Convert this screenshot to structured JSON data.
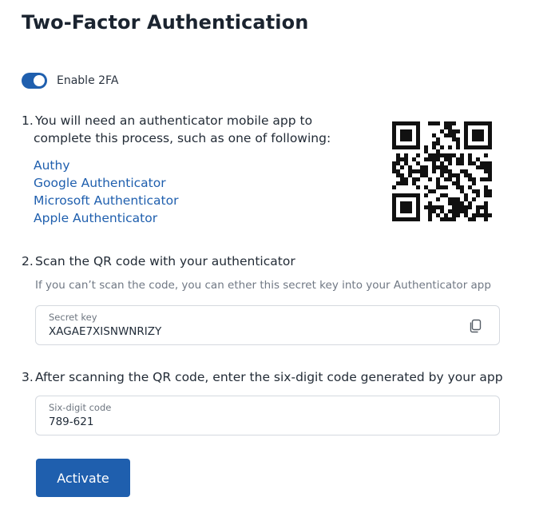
{
  "page": {
    "title": "Two-Factor Authentication"
  },
  "toggle": {
    "label": "Enable 2FA",
    "enabled": true,
    "accent": "#1f5fae"
  },
  "step1": {
    "number": "1.",
    "line1": "You will need an authenticator mobile app to",
    "line2": "complete this process, such as one of following:",
    "apps": [
      "Authy",
      "Google Authenticator",
      "Microsoft Authenticator",
      "Apple Authenticator"
    ]
  },
  "qr": {
    "icon": "qr-code"
  },
  "step2": {
    "number": "2.",
    "text": "Scan the QR code with your authenticator",
    "hint": "If you can’t scan the code, you can ether this secret key into your Authenticator app"
  },
  "secret": {
    "label": "Secret key",
    "value": "XAGAE7XISNWNRIZY",
    "icon": "copy-icon"
  },
  "step3": {
    "number": "3.",
    "text": "After scanning the QR code, enter the six-digit code generated by your app"
  },
  "code": {
    "label": "Six-digit code",
    "value": "789-621"
  },
  "actions": {
    "activate_label": "Activate"
  }
}
